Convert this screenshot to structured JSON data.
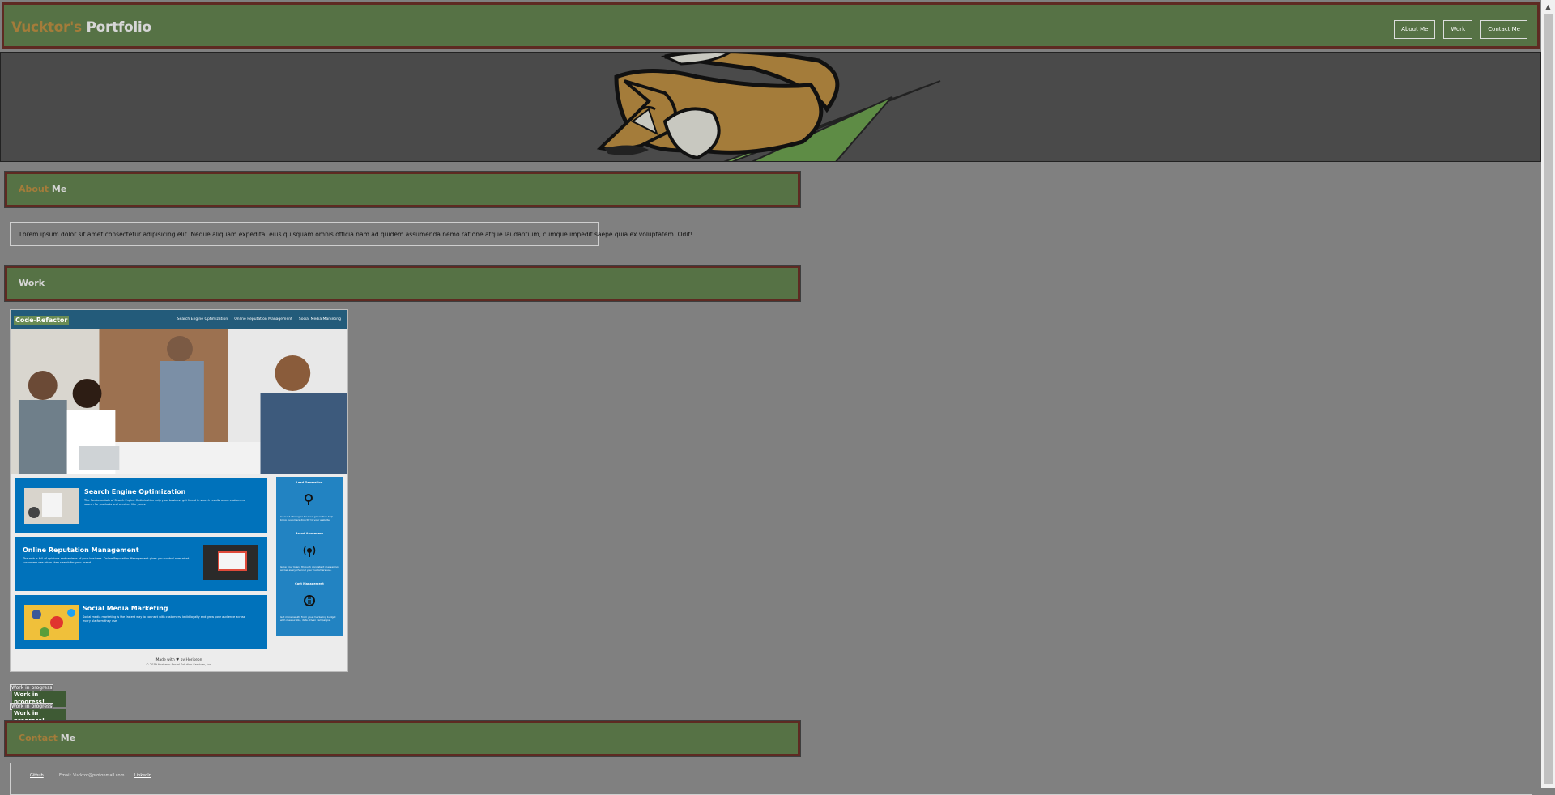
{
  "header": {
    "brand_accent": "Vucktor's",
    "brand_rest": "Portfolio",
    "nav": [
      "About Me",
      "Work",
      "Contact Me"
    ]
  },
  "about": {
    "heading_accent": "About",
    "heading_rest": "Me",
    "text": "Lorem ipsum dolor sit amet consectetur adipisicing elit. Neque aliquam expedita, eius quisquam omnis officia nam ad quidem assumenda nemo ratione atque laudantium, cumque impedit saepe quia ex voluptatem. Odit!"
  },
  "work": {
    "heading": "Work",
    "project": {
      "logo": "Code-Refactor",
      "nav_links": [
        "Search Engine Optimization",
        "Online Reputation Management",
        "Social Media Marketing"
      ],
      "blocks": [
        {
          "title": "Search Engine Optimization",
          "text": "The fundamentals of Search Engine Optimization help your business get found in search results when customers search for products and services like yours."
        },
        {
          "title": "Online Reputation Management",
          "text": "The web is full of opinions and reviews of your business. Online Reputation Management gives you control over what customers see when they search for your brand."
        },
        {
          "title": "Social Media Marketing",
          "text": "Social media marketing is the fastest way to connect with customers, build loyalty and grow your audience across every platform they use."
        }
      ],
      "side": [
        {
          "title": "Lead Generation",
          "text": "Inbound strategies for lead generation help bring customers directly to your website."
        },
        {
          "title": "Brand Awareness",
          "text": "Grow your brand through consistent messaging across every channel your customers use."
        },
        {
          "title": "Cost Management",
          "text": "Get more results from your marketing budget with measurable, data driven campaigns."
        }
      ],
      "footer": "Made with ♥ by Horiseon",
      "copyright": "© 2019 Horiseon Social Solution Services, Inc."
    },
    "wip": [
      {
        "alt": "Work in progress",
        "caption": "Work in progress!"
      },
      {
        "alt": "Work in progress",
        "caption": "Work in progress!"
      }
    ]
  },
  "contact": {
    "heading_accent": "Contact",
    "heading_rest": "Me",
    "items": [
      "Github",
      "Email: Vucktor@protonmail.com",
      "LinkedIn"
    ]
  },
  "colors": {
    "page_bg": "#808080",
    "bar_green": "#567245",
    "bar_border": "#5e2a22",
    "accent_gold": "#a47c3a",
    "hero_bg": "#4a4a4a",
    "site_blue": "#0072bb"
  },
  "icons": [
    "fox-logo",
    "lead-icon",
    "brand-icon",
    "cost-icon",
    "scroll-up-icon"
  ]
}
